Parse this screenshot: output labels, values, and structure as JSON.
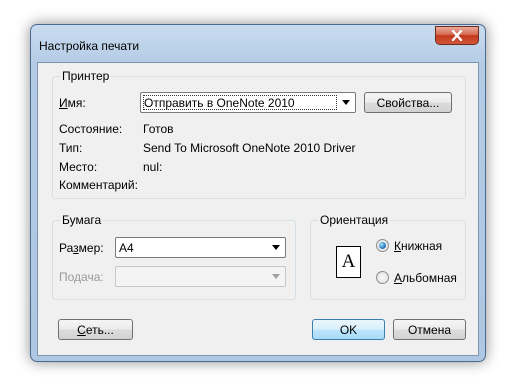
{
  "window": {
    "title": "Настройка печати"
  },
  "printer": {
    "group_label": "Принтер",
    "name_label": "Имя:",
    "name_value": "Отправить в OneNote 2010",
    "properties_button": "Свойства...",
    "status_label": "Состояние:",
    "status_value": "Готов",
    "type_label": "Тип:",
    "type_value": "Send To Microsoft OneNote 2010 Driver",
    "where_label": "Место:",
    "where_value": "nul:",
    "comment_label": "Комментарий:"
  },
  "paper": {
    "group_label": "Бумага",
    "size_label": "Размер:",
    "size_value": "A4",
    "source_label": "Подача:",
    "source_value": ""
  },
  "orientation": {
    "group_label": "Ориентация",
    "icon_letter": "A",
    "portrait_label": "Книжная",
    "landscape_label": "Альбомная",
    "selected": "portrait"
  },
  "buttons": {
    "network": "Сеть...",
    "ok": "OK",
    "cancel": "Отмена"
  },
  "colors": {
    "frame": "#aec7e2",
    "close": "#c2391c",
    "accent": "#3c7fb1"
  }
}
